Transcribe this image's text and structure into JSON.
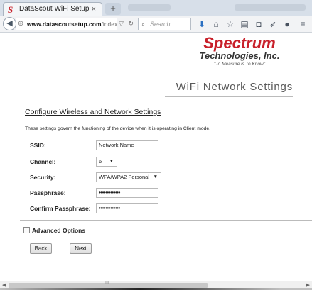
{
  "browser": {
    "tab_title": "DataScout WiFi Setup",
    "tab_close": "×",
    "new_tab": "+",
    "url_domain": "www.datascoutsetup.com",
    "url_path": "/index.html",
    "search_placeholder": "Search",
    "toolbar_icons": [
      "download-icon",
      "home-icon",
      "star-icon",
      "reading-list-icon",
      "pocket-icon",
      "send-icon",
      "chat-icon",
      "menu-icon"
    ]
  },
  "logo": {
    "main": "Spectrum",
    "sub": "Technologies, Inc.",
    "tagline": "\"To Measure is To Know\""
  },
  "page": {
    "title": "WiFi Network Settings",
    "section_title": "Configure Wireless and Network Settings",
    "description": "These settings govern the functioning of the device when it is operating in Client mode."
  },
  "form": {
    "ssid_label": "SSID:",
    "ssid_value": "Network Name",
    "channel_label": "Channel:",
    "channel_value": "6",
    "security_label": "Security:",
    "security_value": "WPA/WPA2 Personal",
    "passphrase_label": "Passphrase:",
    "passphrase_value": "•••••••••••••",
    "confirm_label": "Confirm Passphrase:",
    "confirm_value": "•••••••••••••",
    "advanced_label": "Advanced Options",
    "advanced_checked": false,
    "back_label": "Back",
    "next_label": "Next"
  },
  "scrollbar": {
    "grip": "III"
  }
}
